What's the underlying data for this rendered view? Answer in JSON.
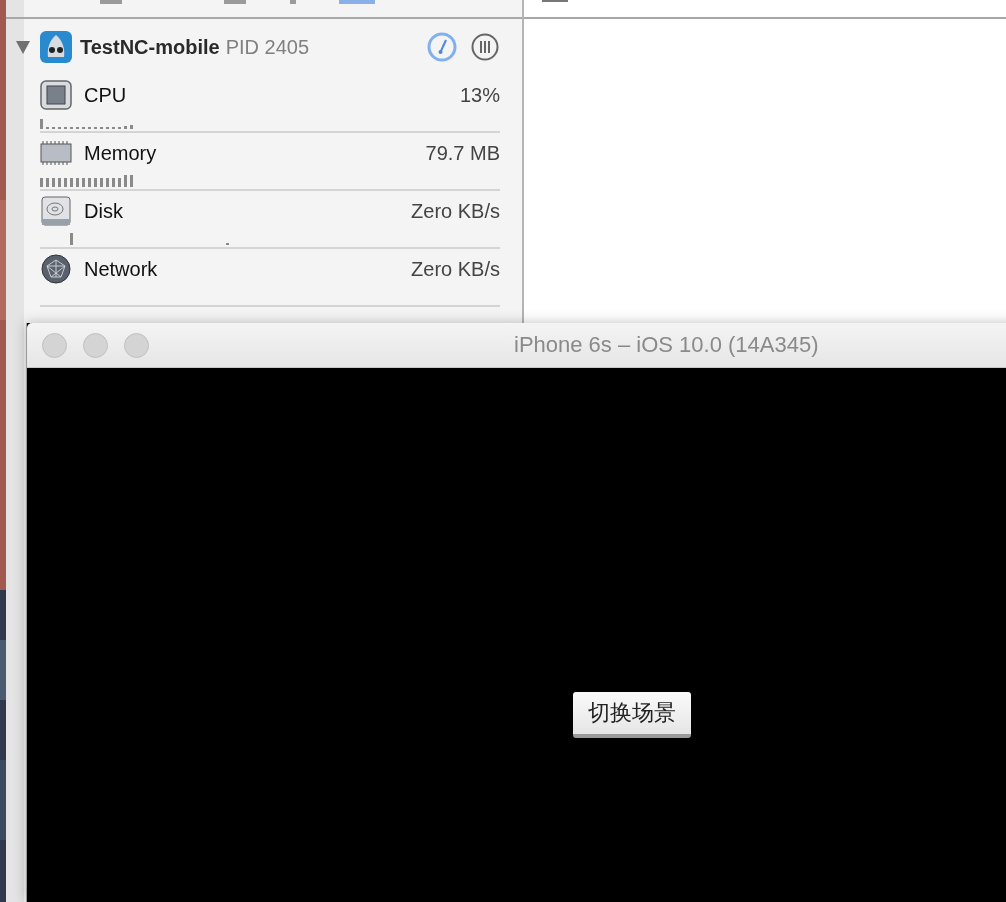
{
  "process": {
    "name": "TestNC-mobile",
    "pid": "PID 2405",
    "expanded": true
  },
  "gauges": [
    {
      "kind": "cpu",
      "label": "CPU",
      "reading": "13%"
    },
    {
      "kind": "memory",
      "label": "Memory",
      "reading": "79.7 MB"
    },
    {
      "kind": "disk",
      "label": "Disk",
      "reading": "Zero KB/s"
    },
    {
      "kind": "network",
      "label": "Network",
      "reading": "Zero KB/s"
    }
  ],
  "simulator": {
    "title": "iPhone 6s – iOS 10.0 (14A345)",
    "button": "切换场景"
  }
}
